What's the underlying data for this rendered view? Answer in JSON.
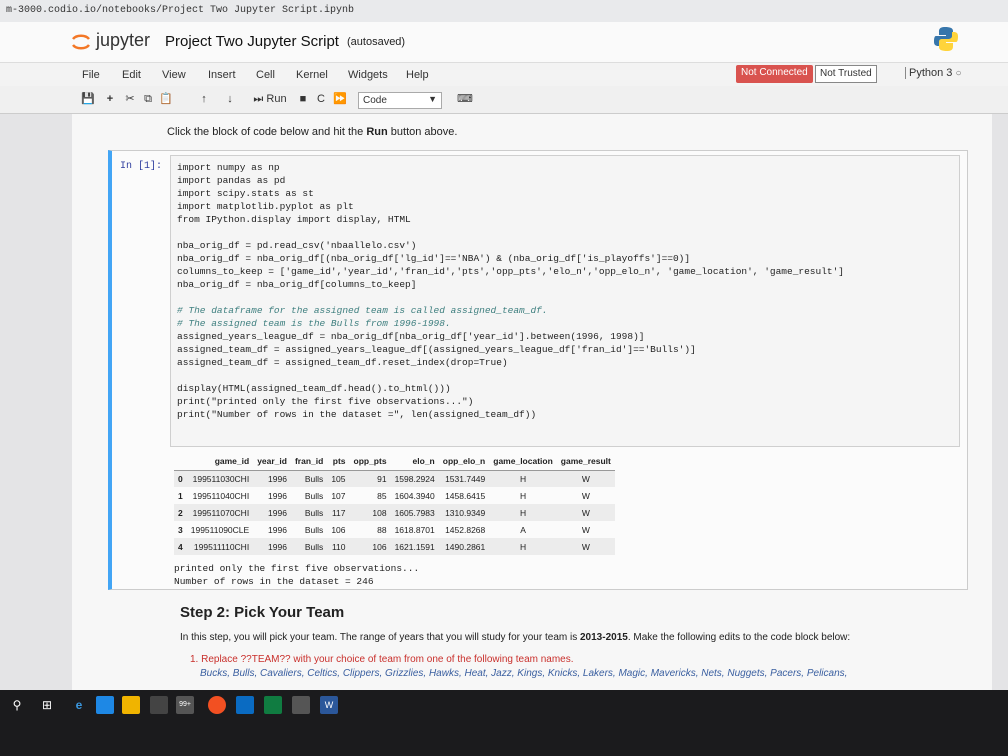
{
  "browser": {
    "url": "m-3000.codio.io/notebooks/Project Two Jupyter Script.ipynb"
  },
  "header": {
    "logo_text": "jupyter",
    "notebook_title": "Project Two Jupyter Script",
    "autosave_status": "(autosaved)"
  },
  "menu": {
    "items": [
      "File",
      "Edit",
      "View",
      "Insert",
      "Cell",
      "Kernel",
      "Widgets",
      "Help"
    ],
    "status": {
      "connection": "Not Connected",
      "trust": "Not Trusted",
      "kernel": "Python 3"
    }
  },
  "toolbar": {
    "buttons": [
      "💾",
      "+",
      "✂",
      "⧉",
      "📋",
      "↑",
      "↓"
    ],
    "run_label": "Run",
    "cell_type": "Code"
  },
  "notebook": {
    "instruction": [
      "Click the block of code below and hit the ",
      "Run",
      " button above."
    ],
    "cell_prompt": "In [1]:",
    "code_lines": [
      "import numpy as np",
      "import pandas as pd",
      "import scipy.stats as st",
      "import matplotlib.pyplot as plt",
      "from IPython.display import display, HTML",
      "",
      "nba_orig_df = pd.read_csv('nbaallelo.csv')",
      "nba_orig_df = nba_orig_df[(nba_orig_df['lg_id']=='NBA') & (nba_orig_df['is_playoffs']==0)]",
      "columns_to_keep = ['game_id','year_id','fran_id','pts','opp_pts','elo_n','opp_elo_n', 'game_location', 'game_result']",
      "nba_orig_df = nba_orig_df[columns_to_keep]",
      "",
      "# The dataframe for the assigned team is called assigned_team_df.",
      "# The assigned team is the Bulls from 1996-1998.",
      "assigned_years_league_df = nba_orig_df[nba_orig_df['year_id'].between(1996, 1998)]",
      "assigned_team_df = assigned_years_league_df[(assigned_years_league_df['fran_id']=='Bulls')]",
      "assigned_team_df = assigned_team_df.reset_index(drop=True)",
      "",
      "display(HTML(assigned_team_df.head().to_html()))",
      "print(\"printed only the first five observations...\")",
      "print(\"Number of rows in the dataset =\", len(assigned_team_df))"
    ],
    "output_table": {
      "columns": [
        "",
        "game_id",
        "year_id",
        "fran_id",
        "pts",
        "opp_pts",
        "elo_n",
        "opp_elo_n",
        "game_location",
        "game_result"
      ],
      "rows": [
        [
          "0",
          "199511030CHI",
          "1996",
          "Bulls",
          "105",
          "91",
          "1598.2924",
          "1531.7449",
          "H",
          "W"
        ],
        [
          "1",
          "199511040CHI",
          "1996",
          "Bulls",
          "107",
          "85",
          "1604.3940",
          "1458.6415",
          "H",
          "W"
        ],
        [
          "2",
          "199511070CHI",
          "1996",
          "Bulls",
          "117",
          "108",
          "1605.7983",
          "1310.9349",
          "H",
          "W"
        ],
        [
          "3",
          "199511090CLE",
          "1996",
          "Bulls",
          "106",
          "88",
          "1618.8701",
          "1452.8268",
          "A",
          "W"
        ],
        [
          "4",
          "199511110CHI",
          "1996",
          "Bulls",
          "110",
          "106",
          "1621.1591",
          "1490.2861",
          "H",
          "W"
        ]
      ]
    },
    "output_lines": [
      "printed only the first five observations...",
      "Number of rows in the dataset = 246"
    ],
    "step2": {
      "title": "Step 2: Pick Your Team",
      "description_parts": [
        "In this step, you will pick your team. The range of years that you will study for your team is ",
        "2013-2015",
        ". Make the following edits to the code block below:"
      ],
      "item_1": "1. Replace ??TEAM?? with your choice of team from one of the following team names.",
      "team_names": "Bucks, Bulls, Cavaliers, Celtics, Clippers, Grizzlies, Hawks, Heat, Jazz, Kings, Knicks, Lakers, Magic, Mavericks, Nets, Nuggets, Pacers, Pelicans,"
    }
  },
  "colors": {
    "cell_border": "#42a5f5",
    "not_connected_bg": "#d9534f",
    "taskbar_bg": "#1b1b1d"
  }
}
